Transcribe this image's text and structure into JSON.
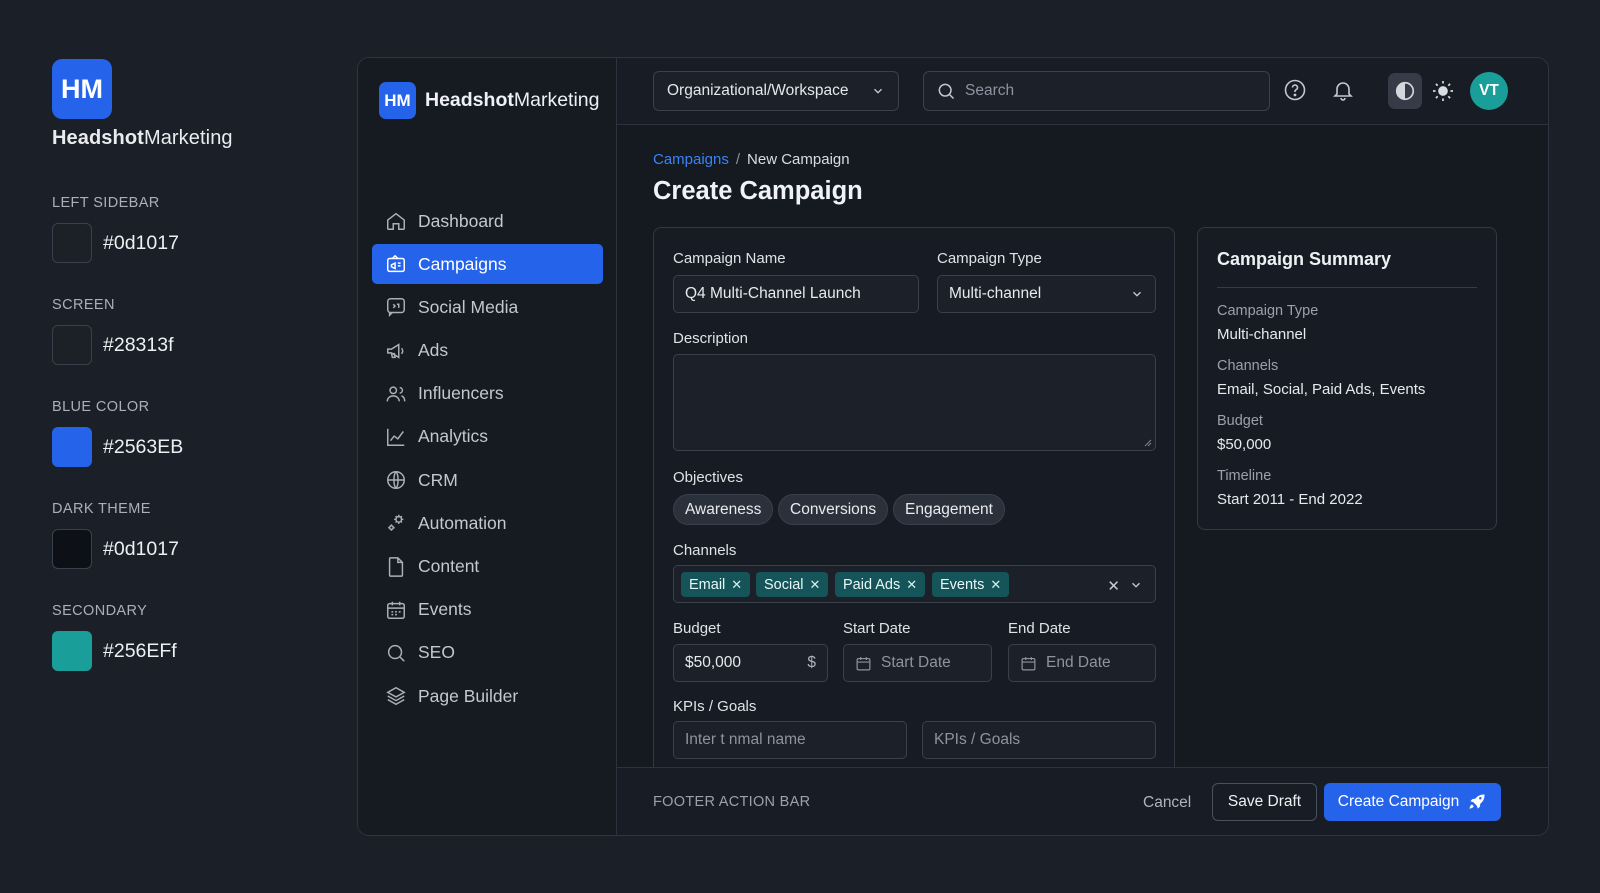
{
  "guide": {
    "logo_text": "HM",
    "brand_bold": "Headshot",
    "brand_rest": "Marketing",
    "swatches": [
      {
        "label": "LEFT SIDEBAR",
        "hex": "#0d1017",
        "color": "#1c2027"
      },
      {
        "label": "SCREEN",
        "hex": "#28313f",
        "color": "#1c2027"
      },
      {
        "label": "BLUE COLOR",
        "hex": "#2563EB",
        "color": "#2563eb"
      },
      {
        "label": "DARK THEME",
        "hex": "#0d1017",
        "color": "#0d1017"
      },
      {
        "label": "SECONDARY",
        "hex": "#256EFf",
        "color": "#1a9e9a"
      }
    ]
  },
  "sidebar": {
    "logo_text": "HM",
    "brand_bold": "Headshot",
    "brand_rest": "Marketing",
    "items": [
      {
        "label": "Dashboard",
        "icon": "home-icon"
      },
      {
        "label": "Campaigns",
        "icon": "megaphone-board-icon"
      },
      {
        "label": "Social Media",
        "icon": "chat-icon"
      },
      {
        "label": "Ads",
        "icon": "megaphone-icon"
      },
      {
        "label": "Influencers",
        "icon": "users-icon"
      },
      {
        "label": "Analytics",
        "icon": "chart-line-icon"
      },
      {
        "label": "CRM",
        "icon": "globe-icon"
      },
      {
        "label": "Automation",
        "icon": "gears-icon"
      },
      {
        "label": "Content",
        "icon": "file-icon"
      },
      {
        "label": "Events",
        "icon": "calendar-icon"
      },
      {
        "label": "SEO",
        "icon": "search-icon"
      },
      {
        "label": "Page Builder",
        "icon": "layers-icon"
      }
    ],
    "active_index": 1
  },
  "topbar": {
    "workspace": "Organizational/Workspace",
    "search_placeholder": "Search",
    "avatar_initials": "VT"
  },
  "breadcrumb": {
    "parent": "Campaigns",
    "separator": "/",
    "current": "New Campaign"
  },
  "page_title": "Create Campaign",
  "form": {
    "name_label": "Campaign Name",
    "name_value": "Q4 Multi-Channel Launch",
    "type_label": "Campaign Type",
    "type_value": "Multi-channel",
    "description_label": "Description",
    "description_value": "",
    "objectives_label": "Objectives",
    "objectives": [
      "Awareness",
      "Conversions",
      "Engagement"
    ],
    "channels_label": "Channels",
    "channels": [
      "Email",
      "Social",
      "Paid Ads",
      "Events"
    ],
    "budget_label": "Budget",
    "budget_value": "$50,000",
    "budget_suffix": "$",
    "start_label": "Start Date",
    "start_placeholder": "Start Date",
    "end_label": "End Date",
    "end_placeholder": "End Date",
    "kpi_label": "KPIs / Goals",
    "kpi_placeholder_1": "Inter t nmal name",
    "kpi_placeholder_2": "KPIs / Goals"
  },
  "summary": {
    "title": "Campaign Summary",
    "rows": [
      {
        "label": "Campaign Type",
        "value": "Multi-channel"
      },
      {
        "label": "Channels",
        "value": "Email, Social, Paid Ads, Events"
      },
      {
        "label": "Budget",
        "value": "$50,000"
      },
      {
        "label": "Timeline",
        "value": "Start 2011 - End 2022"
      }
    ]
  },
  "footer": {
    "label": "FOOTER ACTION BAR",
    "cancel": "Cancel",
    "save_draft": "Save Draft",
    "create": "Create Campaign"
  },
  "colors": {
    "accent": "#2563eb",
    "secondary": "#1a9e9a",
    "chip": "#15555a"
  }
}
